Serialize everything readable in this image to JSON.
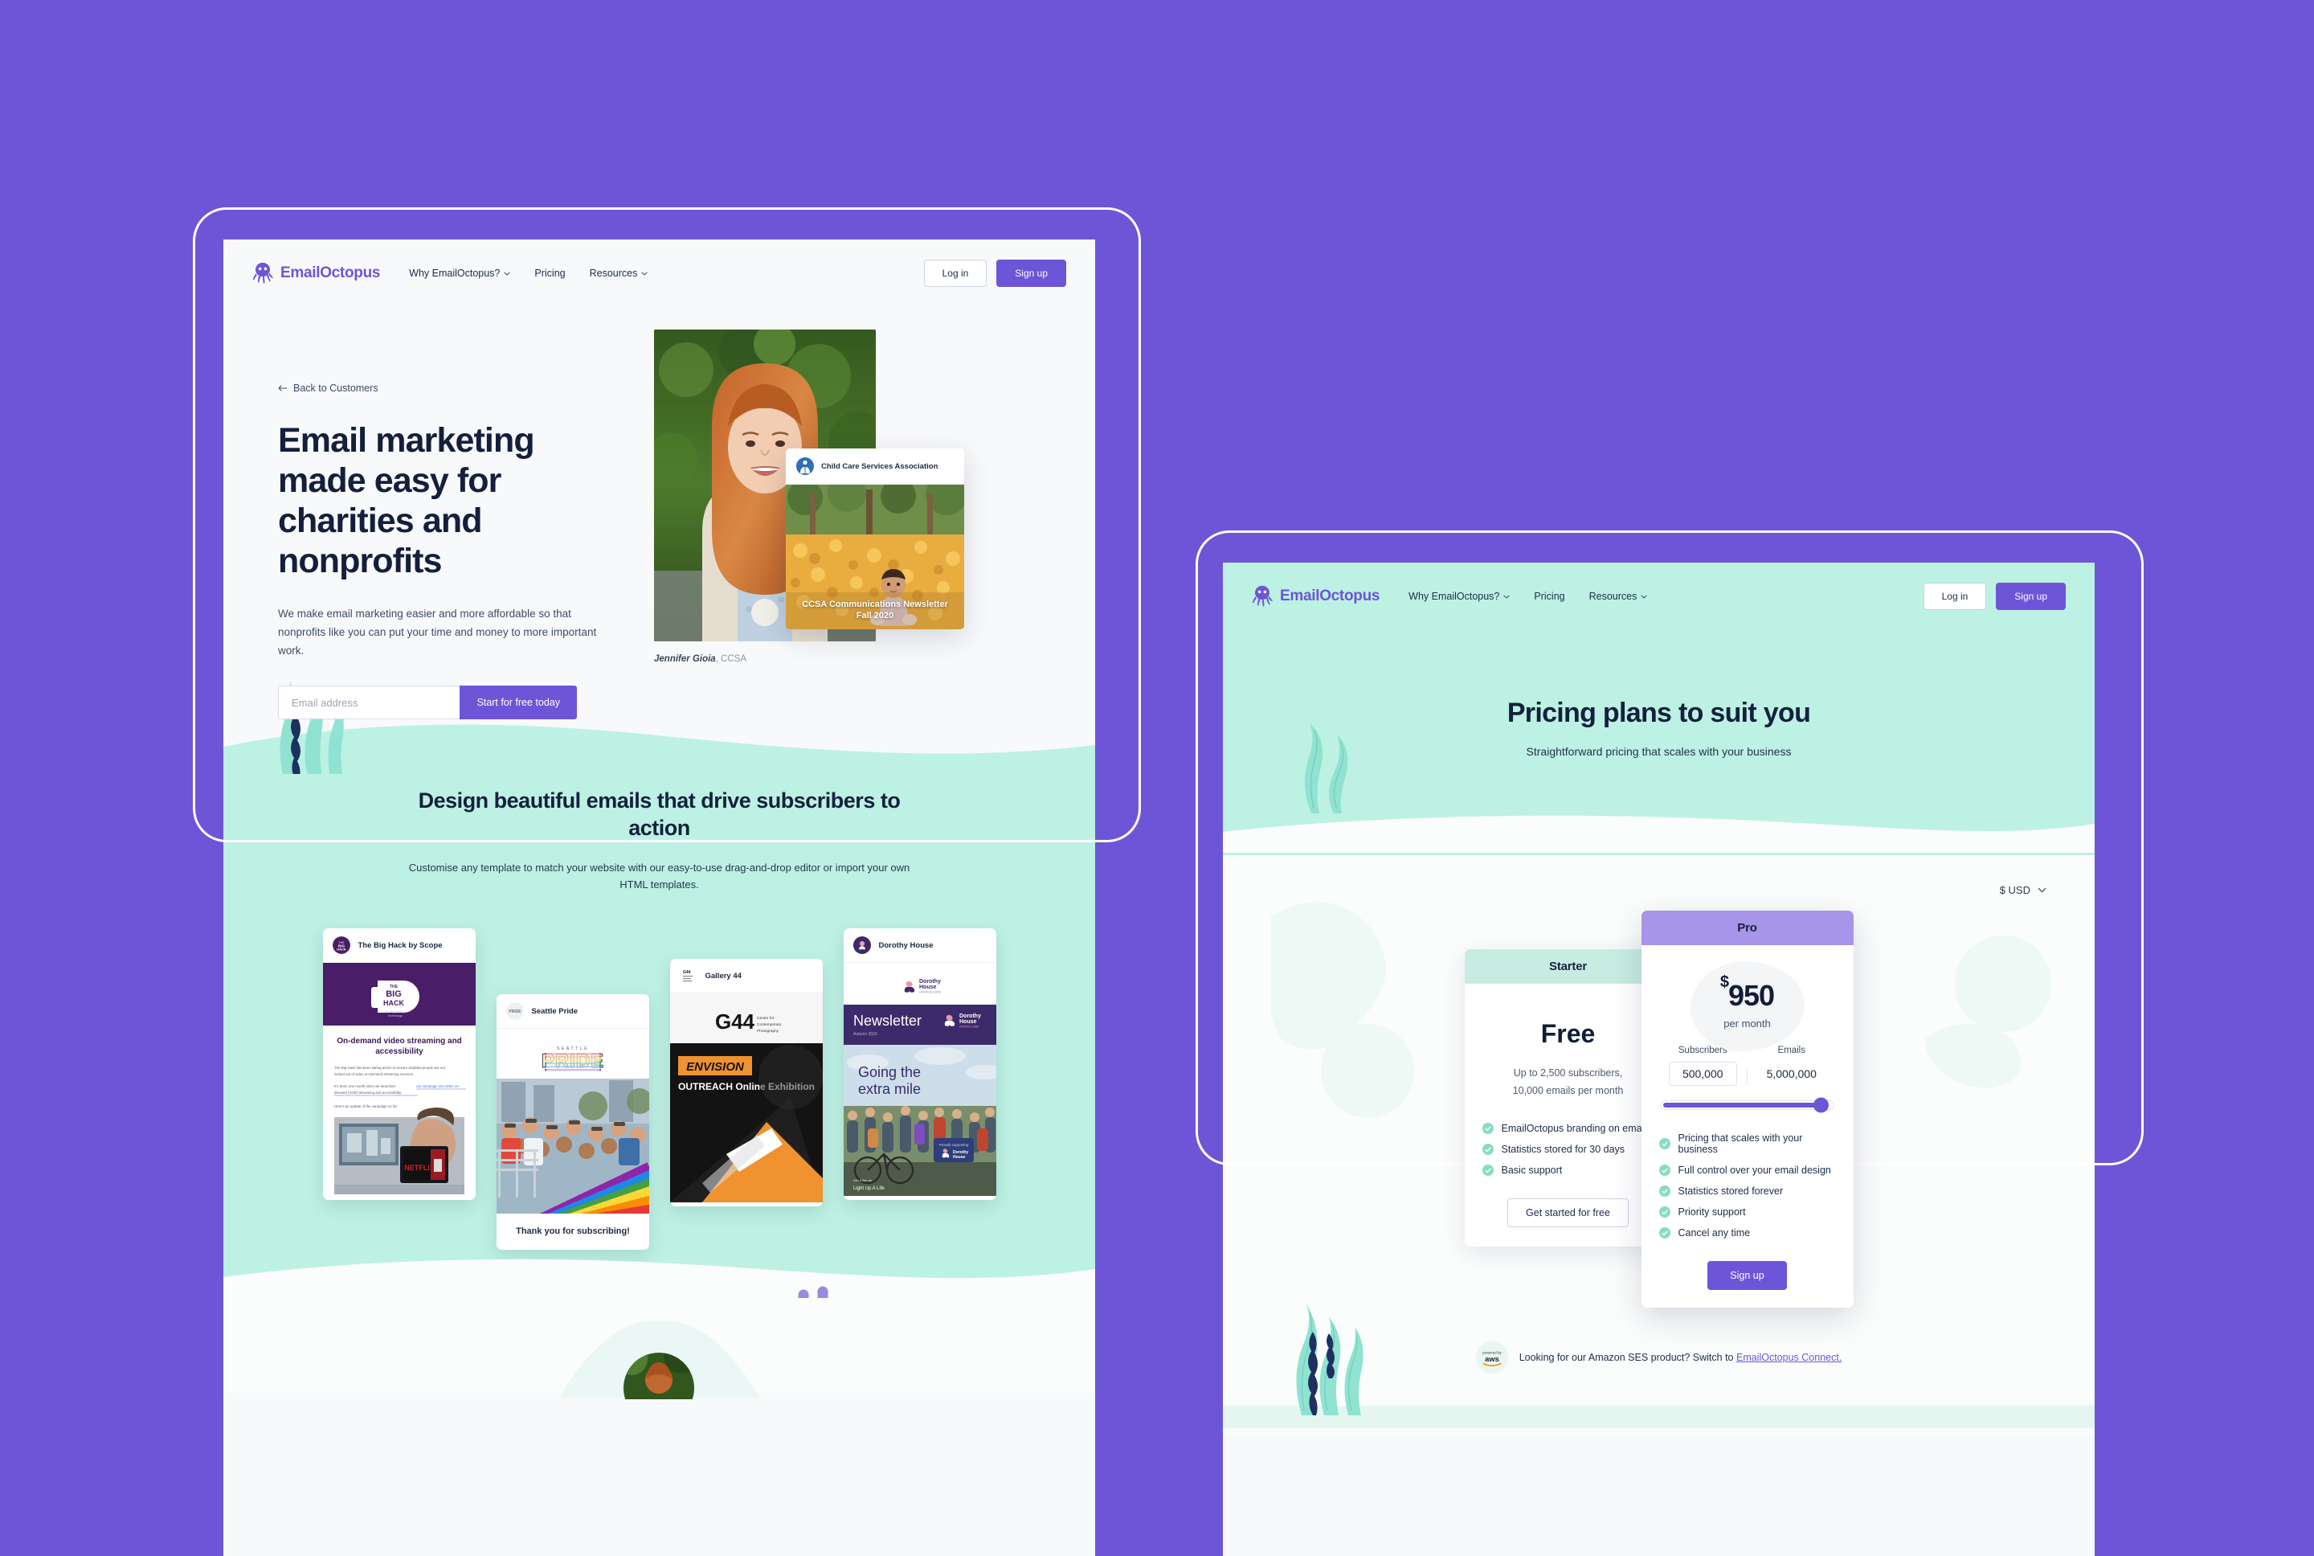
{
  "theme": {
    "background_purple": "#6d55d8",
    "brand_purple": "#6d55d8",
    "mint": "#bdf1e3",
    "navy": "#13203d"
  },
  "header": {
    "brand_name": "EmailOctopus",
    "nav": [
      {
        "label": "Why EmailOctopus?",
        "has_caret": true
      },
      {
        "label": "Pricing",
        "has_caret": false
      },
      {
        "label": "Resources",
        "has_caret": true
      }
    ],
    "login_label": "Log in",
    "signup_label": "Sign up"
  },
  "customers_page": {
    "back_link": "Back to Customers",
    "heading": "Email marketing made easy for charities and nonprofits",
    "subheading": "We make email marketing easier and more affordable so that nonprofits like you can put your time and money to more important work.",
    "email_placeholder": "Email address",
    "email_value": "",
    "cta_label": "Start for free today",
    "photo_caption_name": "Jennifer Gioia",
    "photo_caption_org": ", CCSA",
    "newsletter_card": {
      "org": "Child Care Services Association",
      "caption_line1": "CCSA Communications Newsletter",
      "caption_line2": "Fall 2020"
    },
    "templates_section": {
      "heading": "Design beautiful emails that drive subscribers to action",
      "subheading": "Customise any template to match your website with our easy-to-use drag-and-drop editor or import your own HTML templates.",
      "cards": [
        {
          "sender": "The Big Hack by Scope",
          "hero_logo_line1": "THE",
          "hero_logo_line2": "BIG",
          "hero_logo_line3": "HACK",
          "hero_logo_tagline": "Equality through technology",
          "headline": "On-demand video streaming and accessibility",
          "body1": "The Big Hack has been taking action to ensure disabled people are not locked out of video on-demand streaming services.",
          "body2": "It's been one month since we launched our campaign into video on-demand (VOD) streaming and accessibility.",
          "body3": "Here's an update of the campaign so far.",
          "photo_label": "NETFLIX"
        },
        {
          "sender": "Seattle Pride",
          "logo_line1": "SEATTLE",
          "logo_line2": "PRIDE",
          "footer": "Thank you for subscribing!"
        },
        {
          "sender": "Gallery 44",
          "logo_mark": "G44",
          "logo_sub": "Centre for Contemporary Photography",
          "banner_word": "ENVISION",
          "banner_sub": "OUTREACH Online Exhibition"
        },
        {
          "sender": "Dorothy House",
          "logo_line1": "Dorothy",
          "logo_line2": "House",
          "logo_sub": "HOSPICE CARE",
          "banner_title": "Newsletter",
          "banner_sub": "Autumn 2020",
          "hero_line1": "Going the",
          "hero_line2": "extra mile",
          "hero_footnote1": "Win it like we",
          "hero_footnote2": "Light Up A Life"
        }
      ]
    }
  },
  "pricing_page": {
    "heading": "Pricing plans to suit you",
    "subheading": "Straightforward pricing that scales with your business",
    "currency": "$ USD",
    "plans": [
      {
        "name": "Starter",
        "price": "Free",
        "description_line1": "Up to 2,500 subscribers,",
        "description_line2": "10,000 emails per month",
        "features": [
          "EmailOctopus branding on emails",
          "Statistics stored for 30 days",
          "Basic support"
        ],
        "cta_label": "Get started for free"
      },
      {
        "name": "Pro",
        "currency_symbol": "$",
        "price_amount": "950",
        "price_period": "per month",
        "subscribers_label": "Subscribers",
        "subscribers_value": "500,000",
        "emails_label": "Emails",
        "emails_value": "5,000,000",
        "slider_percent": 93,
        "features": [
          "Pricing that scales with your business",
          "Full control over your email design",
          "Statistics stored forever",
          "Priority support",
          "Cancel any time"
        ],
        "cta_label": "Sign up"
      }
    ],
    "aws_banner": {
      "badge_top": "powered by",
      "badge_name": "aws",
      "text_before": "Looking for our Amazon SES product? Switch to ",
      "link_text": "EmailOctopus Connect."
    }
  }
}
